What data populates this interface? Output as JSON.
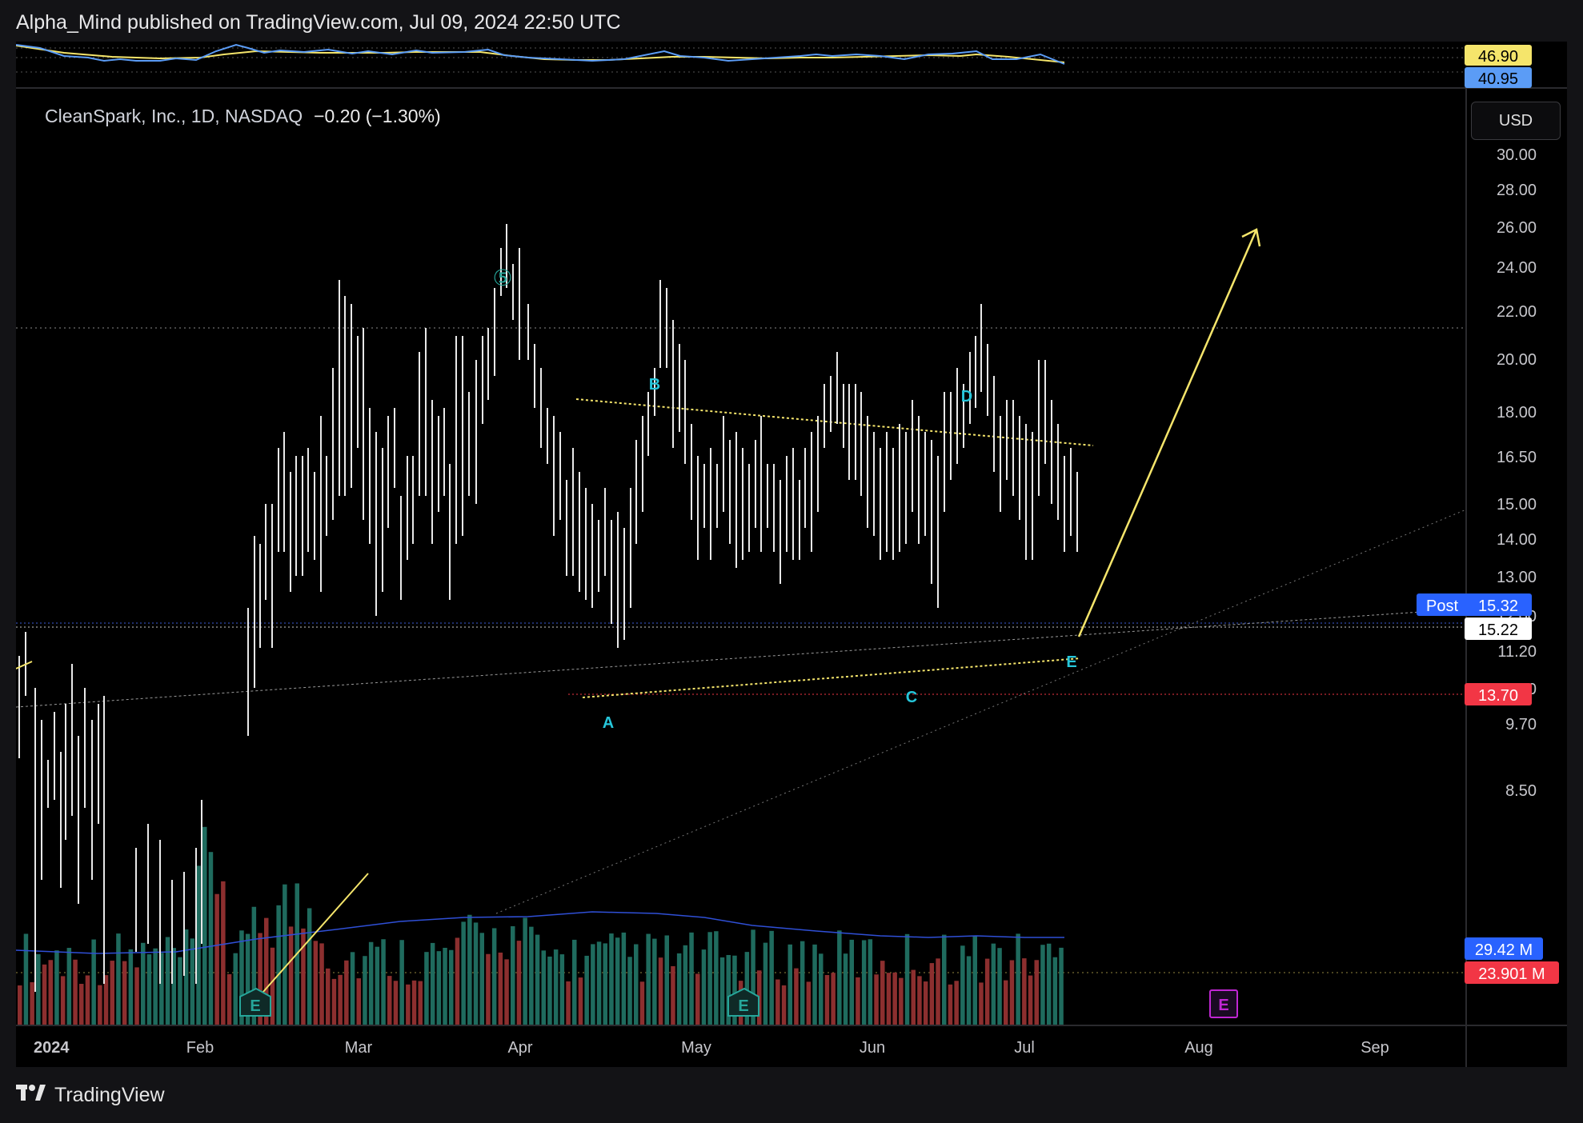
{
  "header": {
    "published": "Alpha_Mind published on TradingView.com, Jul 09, 2024 22:50 UTC"
  },
  "symbol": {
    "name": "CleanSpark, Inc., 1D, NASDAQ",
    "change": "−0.20 (−1.30%)"
  },
  "currency_button": "USD",
  "indicator_pane": {
    "labels": [
      {
        "text": "46.90",
        "color": "#f5e56b",
        "text_color": "#000000"
      },
      {
        "text": "40.95",
        "color": "#5b9cf6",
        "text_color": "#000000"
      }
    ]
  },
  "price_axis": {
    "ticks": [
      "30.00",
      "28.00",
      "26.00",
      "24.00",
      "22.00",
      "20.00",
      "18.00",
      "16.50",
      "15.00",
      "14.00",
      "13.00",
      "12.00",
      "11.20",
      "10.40",
      "9.70",
      "8.50"
    ],
    "post_label": "Post",
    "post_price": "15.32",
    "last_price": "15.22",
    "support_price": "13.70",
    "volume_ma": "29.42 M",
    "volume_last": "23.901 M"
  },
  "time_axis": {
    "labels": [
      "2024",
      "Feb",
      "Mar",
      "Apr",
      "May",
      "Jun",
      "Jul",
      "Aug",
      "Sep"
    ]
  },
  "annotations": {
    "wave_five": "⑤",
    "waves": [
      "A",
      "B",
      "C",
      "D",
      "E"
    ],
    "earnings_marker": "E"
  },
  "colors": {
    "up_volume": "#1f6b5e",
    "down_volume": "#8c2f2f",
    "triangle_lines": "#f5e56b",
    "wave_labels": "#26c6da",
    "arrow": "#f5e56b",
    "support_line": "#f23645",
    "post_label": "#2962ff"
  },
  "footer": {
    "brand": "TradingView"
  }
}
